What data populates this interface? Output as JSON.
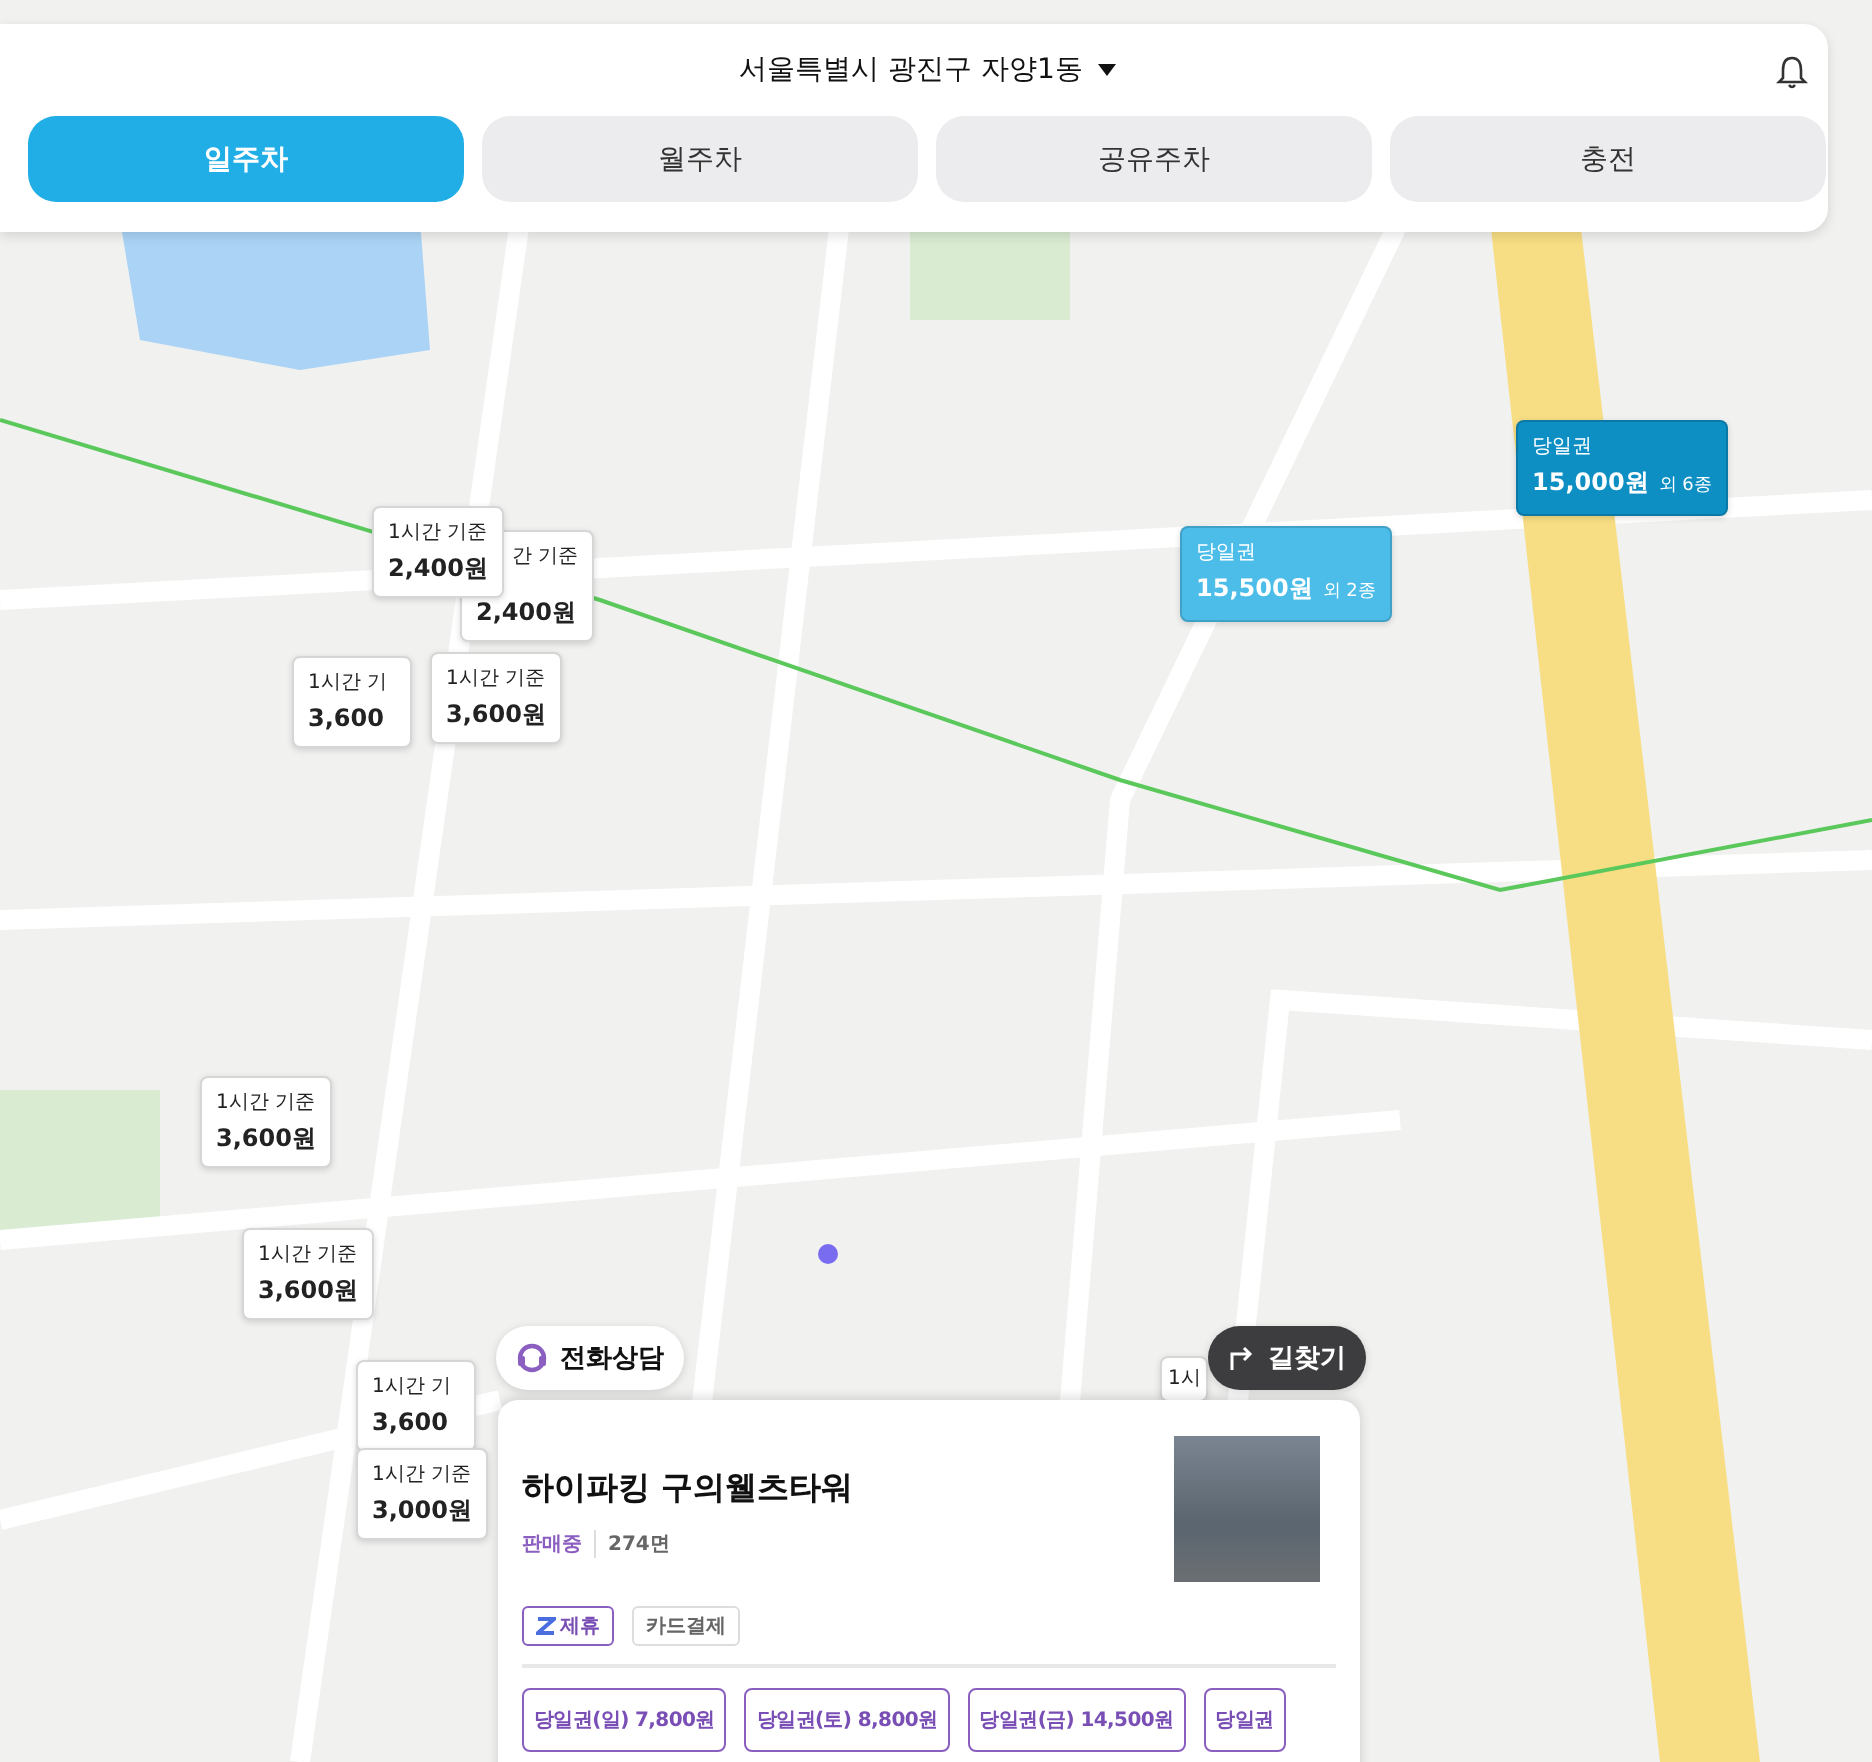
{
  "header": {
    "location": "서울특별시 광진구 자양1동",
    "tabs": [
      {
        "label": "일주차",
        "selected": true
      },
      {
        "label": "월주차",
        "selected": false
      },
      {
        "label": "공유주차",
        "selected": false
      },
      {
        "label": "충전",
        "selected": false
      }
    ]
  },
  "map": {
    "markers": [
      {
        "kind": "hourly",
        "label": "1시간 기준",
        "price": "2,400원"
      },
      {
        "kind": "hourly",
        "label": "간 기준",
        "price": "2,400원"
      },
      {
        "kind": "hourly",
        "label": "1시간 기",
        "price": "3,600"
      },
      {
        "kind": "hourly",
        "label": "1시간 기준",
        "price": "3,600원"
      },
      {
        "kind": "daily",
        "label": "당일권",
        "price": "15,500원",
        "extra": "외 2종",
        "color": "#4cbde9"
      },
      {
        "kind": "daily",
        "label": "당일권",
        "price": "15,000원",
        "extra": "외 6종",
        "color": "#0e8fc4"
      },
      {
        "kind": "hourly",
        "label": "1시간 기준",
        "price": "3,600원"
      },
      {
        "kind": "hourly",
        "label": "1시간 기준",
        "price": "3,600원"
      },
      {
        "kind": "hourly",
        "label": "1시간 기",
        "price": "3,600"
      },
      {
        "kind": "hourly",
        "label": "1시간 기준",
        "price": "3,000원"
      },
      {
        "kind": "hourly",
        "label": "1시"
      }
    ]
  },
  "call_button": "전화상담",
  "directions_button": "길찾기",
  "lot": {
    "name": "하이파킹 구의웰츠타워",
    "status": "판매중",
    "spaces": "274면",
    "tags": [
      {
        "kind": "partner",
        "label": "제휴"
      },
      {
        "kind": "plain",
        "label": "카드결제"
      }
    ],
    "tickets": [
      "당일권(일) 7,800원",
      "당일권(토) 8,800원",
      "당일권(금) 14,500원",
      "당일권"
    ]
  }
}
